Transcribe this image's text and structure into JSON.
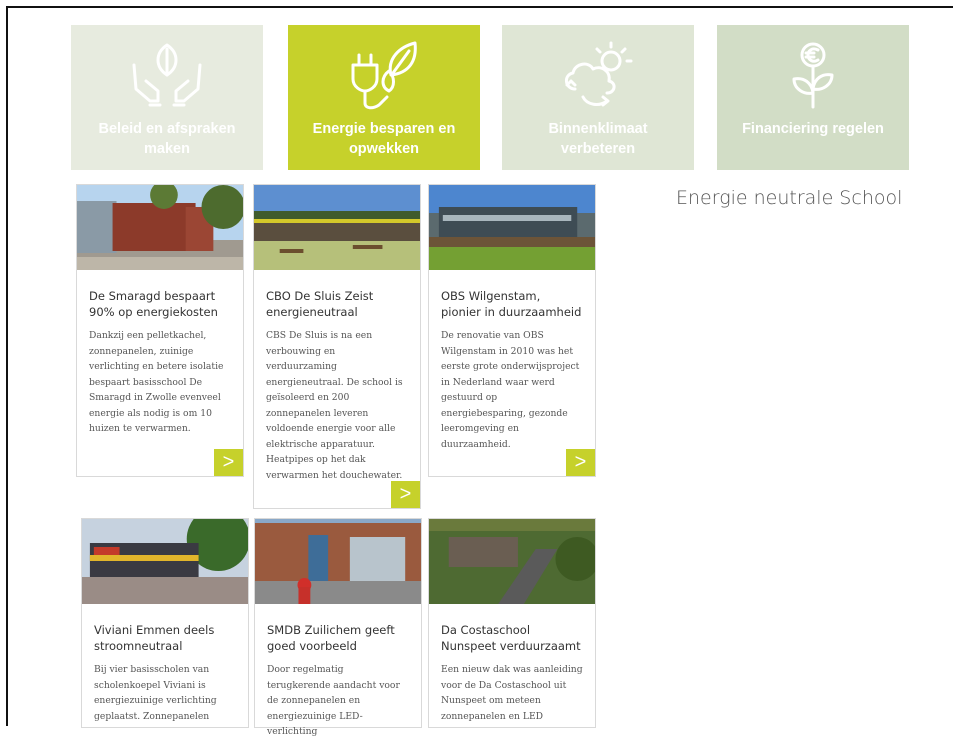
{
  "tiles": [
    {
      "label": "Beleid en afspraken maken",
      "icon": "hands-leaf-icon"
    },
    {
      "label": "Energie besparen en opwekken",
      "icon": "plug-leaf-icon"
    },
    {
      "label": "Binnenklimaat verbeteren",
      "icon": "weather-cycle-icon"
    },
    {
      "label": "Financiering regelen",
      "icon": "money-plant-icon"
    }
  ],
  "sidebar": {
    "title": "Energie neutrale School"
  },
  "cards": [
    {
      "title": "De Smaragd bespaart 90% op energiekosten",
      "text": "Dankzij een pelletkachel, zonnepanelen, zuinige verlichting en betere isolatie bespaart basisschool De Smaragd in Zwolle evenveel energie als nodig is om 10 huizen te verwarmen.",
      "more": ">"
    },
    {
      "title": "CBO De Sluis Zeist energieneutraal",
      "text": "CBS De Sluis is na een verbouwing en verduurzaming energieneutraal. De school is geïsoleerd en 200 zonnepanelen leveren voldoende energie voor alle elektrische apparatuur. Heatpipes op het dak verwarmen het douchewater.",
      "more": ">"
    },
    {
      "title": "OBS Wilgenstam, pionier in duurzaamheid",
      "text": "De renovatie van OBS Wilgenstam in 2010 was het eerste grote onderwijsproject in Nederland waar werd gestuurd op energiebesparing, gezonde leeromgeving en duurzaamheid.",
      "more": ">"
    },
    {
      "title": "Viviani Emmen deels stroomneutraal",
      "text": "Bij vier basisscholen van scholenkoepel Viviani is energiezuinige verlichting geplaatst. Zonnepanelen",
      "more": ""
    },
    {
      "title": "SMDB Zuilichem geeft goed voorbeeld",
      "text": "Door regelmatig terugkerende aandacht voor de zonnepanelen en energiezuinige LED-verlichting",
      "more": ""
    },
    {
      "title": "Da Costaschool Nunspeet verduurzaamt",
      "text": "Een nieuw dak was aanleiding voor de Da Costaschool uit Nunspeet om meteen zonnepanelen en LED",
      "more": ""
    }
  ]
}
